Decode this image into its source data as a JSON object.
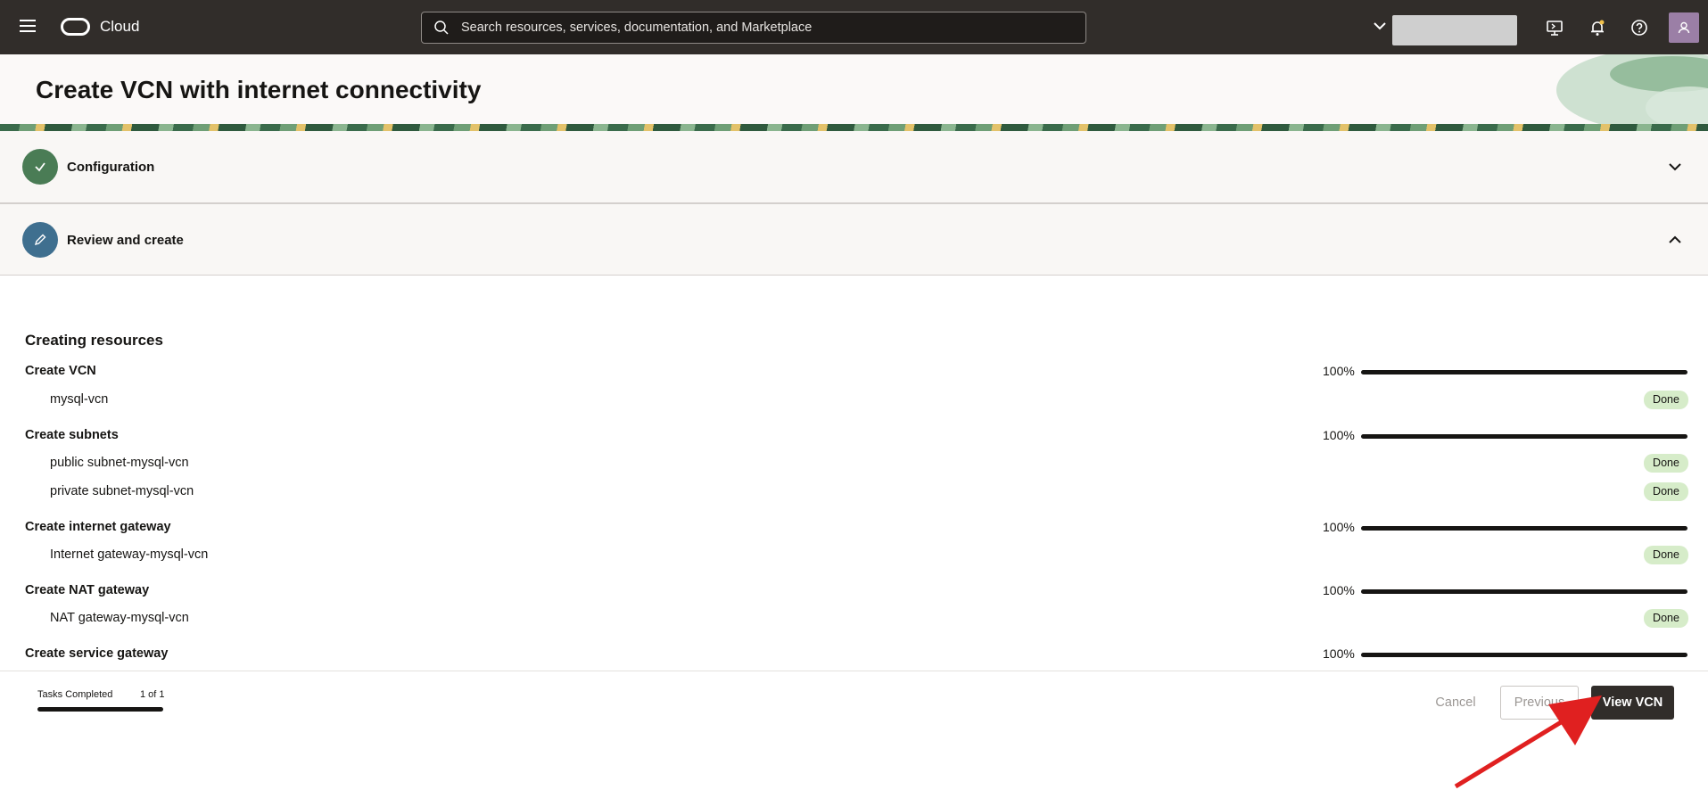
{
  "topbar": {
    "brand": "Cloud",
    "search_placeholder": "Search resources, services, documentation, and Marketplace"
  },
  "page": {
    "title": "Create VCN with internet connectivity"
  },
  "steps": [
    {
      "label": "Configuration",
      "state": "complete"
    },
    {
      "label": "Review and create",
      "state": "current"
    }
  ],
  "resources": {
    "heading": "Creating resources",
    "groups": [
      {
        "title": "Create VCN",
        "percent": "100%",
        "progress": 1.0,
        "items": [
          {
            "name": "mysql-vcn",
            "status": "Done"
          }
        ]
      },
      {
        "title": "Create subnets",
        "percent": "100%",
        "progress": 1.0,
        "items": [
          {
            "name": "public subnet-mysql-vcn",
            "status": "Done"
          },
          {
            "name": "private subnet-mysql-vcn",
            "status": "Done"
          }
        ]
      },
      {
        "title": "Create internet gateway",
        "percent": "100%",
        "progress": 1.0,
        "items": [
          {
            "name": "Internet gateway-mysql-vcn",
            "status": "Done"
          }
        ]
      },
      {
        "title": "Create NAT gateway",
        "percent": "100%",
        "progress": 1.0,
        "items": [
          {
            "name": "NAT gateway-mysql-vcn",
            "status": "Done"
          }
        ]
      },
      {
        "title": "Create service gateway",
        "percent": "100%",
        "progress": 1.0,
        "items": []
      }
    ]
  },
  "footer": {
    "tasks_label": "Tasks Completed",
    "tasks_count": "1 of 1",
    "tasks_progress": 1.0,
    "cancel_label": "Cancel",
    "previous_label": "Previous",
    "view_label": "View VCN"
  },
  "colors": {
    "topbar": "#312d2a",
    "done_badge": "#d6ecc9",
    "annotation_arrow": "#e02020"
  }
}
